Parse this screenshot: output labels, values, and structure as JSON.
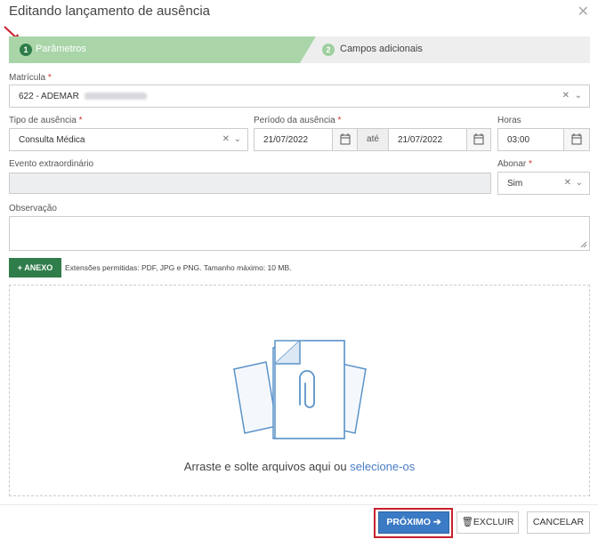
{
  "dialog": {
    "title": "Editando lançamento de ausência",
    "close_icon": "close-icon"
  },
  "steps": [
    {
      "number": "1",
      "label": "Parâmetros",
      "active": true,
      "color": "#a9d5a9"
    },
    {
      "number": "2",
      "label": "Campos adicionais",
      "active": false,
      "color": "#eeeeee"
    }
  ],
  "form": {
    "matricula": {
      "label": "Matrícula",
      "required": "*",
      "value": "622 - ADEMAR"
    },
    "tipo_ausencia": {
      "label": "Tipo de ausência",
      "required": "*",
      "value": "Consulta Médica"
    },
    "periodo": {
      "label": "Período da ausência",
      "required": "*",
      "start": "21/07/2022",
      "separator": "até",
      "end": "21/07/2022"
    },
    "horas": {
      "label": "Horas",
      "value": "03:00"
    },
    "evento": {
      "label": "Evento extraordinário",
      "value": ""
    },
    "abonar": {
      "label": "Abonar",
      "required": "*",
      "value": "Sim"
    },
    "observacao": {
      "label": "Observação",
      "value": ""
    }
  },
  "attachment": {
    "button_label": "+ ANEXO",
    "info": "Extensões permitidas: PDF, JPG e PNG. Tamanho máximo: 10 MB.",
    "dropzone_text": "Arraste e solte arquivos aqui ou ",
    "dropzone_link": "selecione-os"
  },
  "footer": {
    "next_label": "PRÓXIMO",
    "delete_label": "EXCLUIR",
    "cancel_label": "CANCELAR"
  },
  "colors": {
    "accent_green": "#2f7d4a",
    "primary_blue": "#3b7ac4",
    "highlight_red": "#c8202d"
  }
}
